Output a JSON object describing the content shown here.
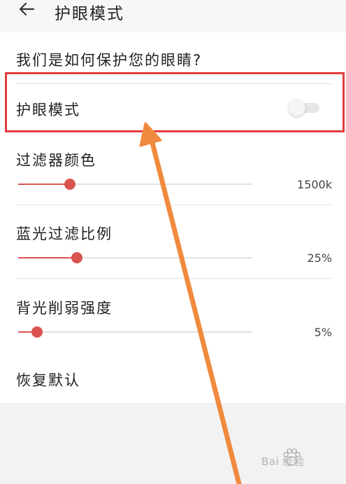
{
  "header": {
    "title": "护眼模式"
  },
  "help": {
    "label": "我们是如何保护您的眼睛?"
  },
  "eye_mode": {
    "label": "护眼模式",
    "enabled": false
  },
  "filter_color": {
    "label": "过滤器颜色",
    "value_text": "1500k",
    "level_percent": 22
  },
  "blue_light": {
    "label": "蓝光过滤比例",
    "value_text": "25%",
    "level_percent": 25
  },
  "backlight": {
    "label": "背光削弱强度",
    "value_text": "5%",
    "level_percent": 8
  },
  "reset": {
    "label": "恢复默认"
  },
  "watermark": {
    "text": "Bai 经验"
  },
  "colors": {
    "accent": "#d9534f",
    "highlight_box": "#e23b3b",
    "arrow": "#f08a3e"
  }
}
